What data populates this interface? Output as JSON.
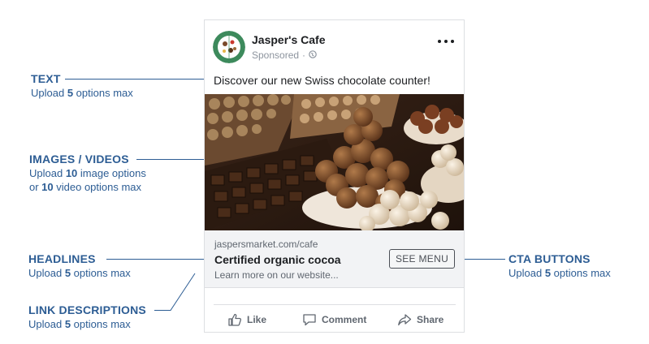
{
  "ad": {
    "page_name": "Jasper's Cafe",
    "sponsored": "Sponsored",
    "sponsored_separator": "·",
    "primary_text": "Discover our new Swiss chocolate counter!",
    "link": {
      "domain": "jaspersmarket.com/cafe",
      "headline": "Certified organic cocoa",
      "description": "Learn more on our website...",
      "cta": "SEE MENU"
    },
    "actions": [
      {
        "label": "Like",
        "icon": "thumbs-up-icon"
      },
      {
        "label": "Comment",
        "icon": "comment-bubble-icon"
      },
      {
        "label": "Share",
        "icon": "share-arrow-icon"
      }
    ]
  },
  "annotations": {
    "text": {
      "title": "TEXT",
      "prefix": "Upload ",
      "num": "5",
      "suffix": " options max"
    },
    "images": {
      "title": "IMAGES / VIDEOS",
      "line1_prefix": "Upload ",
      "line1_num": "10",
      "line1_suffix": " image options",
      "line2_prefix": "or ",
      "line2_num": "10",
      "line2_suffix": " video options max"
    },
    "headlines": {
      "title": "HEADLINES",
      "prefix": "Upload ",
      "num": "5",
      "suffix": " options max"
    },
    "link_descriptions": {
      "title": "LINK DESCRIPTIONS",
      "prefix": "Upload ",
      "num": "5",
      "suffix": " options max"
    },
    "cta_buttons": {
      "title": "CTA BUTTONS",
      "prefix": "Upload ",
      "num": "5",
      "suffix": " options max"
    }
  },
  "colors": {
    "annotation_blue": "#2d5d94",
    "avatar_green": "#3d8a5c",
    "link_box_bg": "#f2f3f5"
  }
}
